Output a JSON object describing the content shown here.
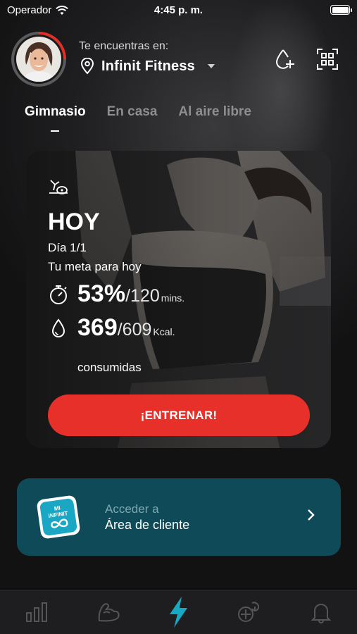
{
  "status_bar": {
    "carrier": "Operador",
    "time": "4:45 p. m."
  },
  "header": {
    "location_label": "Te encuentras en:",
    "gym_name": "Infinit Fitness",
    "icons": [
      "location-pin-icon",
      "chevron-down-icon",
      "add-water-icon",
      "qr-scan-icon"
    ]
  },
  "tabs": [
    {
      "label": "Gimnasio",
      "active": true
    },
    {
      "label": "En casa",
      "active": false
    },
    {
      "label": "Al aire libre",
      "active": false
    }
  ],
  "workout_card": {
    "day_title": "HOY",
    "day_progress": "Día 1/1",
    "goal_label": "Tu meta para hoy",
    "time_stat": {
      "value": "53%",
      "slash": "/120",
      "unit": "mins."
    },
    "calorie_stat": {
      "value": "369",
      "slash": "/609",
      "unit": "Kcal."
    },
    "consumed_label": "consumidas",
    "train_button": "¡ENTRENAR!"
  },
  "client_area": {
    "logo_text_1": "MI",
    "logo_text_2": "INFINIT",
    "line1": "Acceder a",
    "line2": "Área de cliente"
  },
  "bottom_nav": [
    {
      "icon": "stats-icon",
      "active": false
    },
    {
      "icon": "muscle-arm-icon",
      "active": false
    },
    {
      "icon": "lightning-icon",
      "active": true
    },
    {
      "icon": "nutrition-icon",
      "active": false
    },
    {
      "icon": "bell-icon",
      "active": false
    }
  ],
  "colors": {
    "accent_red": "#e8302a",
    "accent_cyan": "#1aa7c4",
    "client_bg": "#0f4a58"
  }
}
